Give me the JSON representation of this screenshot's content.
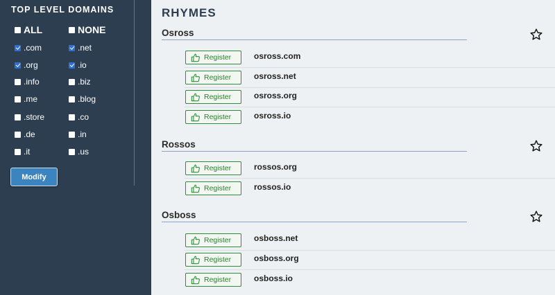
{
  "sidebar": {
    "title": "TOP LEVEL DOMAINS",
    "options": [
      {
        "label": "ALL",
        "checked": false
      },
      {
        "label": "NONE",
        "checked": false
      },
      {
        "label": ".com",
        "checked": true
      },
      {
        "label": ".net",
        "checked": true
      },
      {
        "label": ".org",
        "checked": true
      },
      {
        "label": ".io",
        "checked": true
      },
      {
        "label": ".info",
        "checked": false
      },
      {
        "label": ".biz",
        "checked": false
      },
      {
        "label": ".me",
        "checked": false
      },
      {
        "label": ".blog",
        "checked": false
      },
      {
        "label": ".store",
        "checked": false
      },
      {
        "label": ".co",
        "checked": false
      },
      {
        "label": ".de",
        "checked": false
      },
      {
        "label": ".in",
        "checked": false
      },
      {
        "label": ".it",
        "checked": false
      },
      {
        "label": ".us",
        "checked": false
      }
    ],
    "modify_label": "Modify"
  },
  "main": {
    "heading": "RHYMES",
    "register_label": "Register",
    "groups": [
      {
        "name": "Osross",
        "domains": [
          "osross.com",
          "osross.net",
          "osross.org",
          "osross.io"
        ]
      },
      {
        "name": "Rossos",
        "domains": [
          "rossos.org",
          "rossos.io"
        ]
      },
      {
        "name": "Osboss",
        "domains": [
          "osboss.net",
          "osboss.org",
          "osboss.io"
        ]
      }
    ]
  },
  "colors": {
    "sidebar_bg": "#2c3e50",
    "main_bg": "#eef1f3",
    "accent_blue": "#3b84bf",
    "register_green": "#2e8b3a"
  },
  "icons": {
    "star": "star-outline-icon",
    "thumb": "thumbs-up-icon",
    "checkbox": "checkbox-icon"
  }
}
